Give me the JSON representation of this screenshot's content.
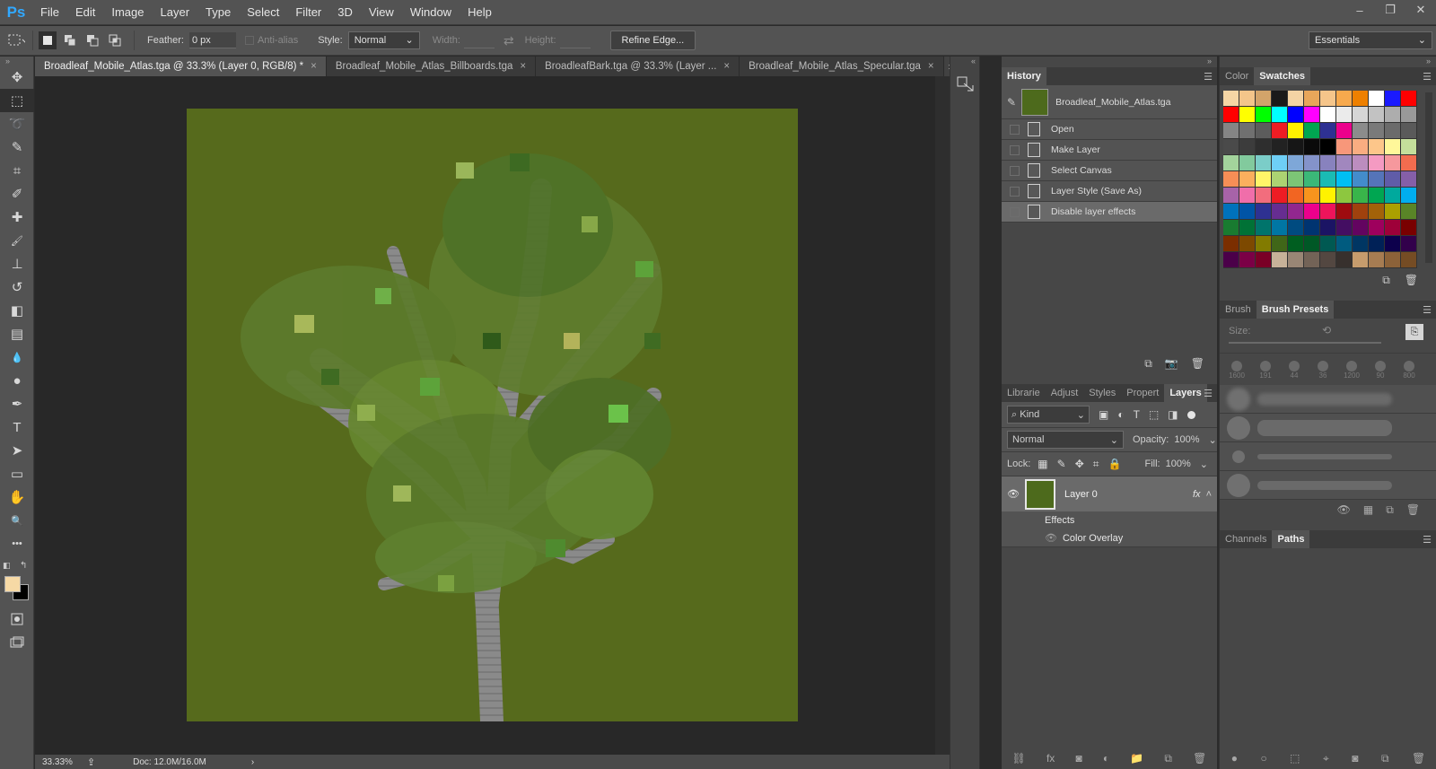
{
  "app": {
    "logo": "Ps",
    "menus": [
      "File",
      "Edit",
      "Image",
      "Layer",
      "Type",
      "Select",
      "Filter",
      "3D",
      "View",
      "Window",
      "Help"
    ],
    "window_controls": [
      "–",
      "❐",
      "✕"
    ]
  },
  "options_bar": {
    "feather_label": "Feather:",
    "feather_value": "0 px",
    "anti_alias_label": "Anti-alias",
    "style_label": "Style:",
    "style_value": "Normal",
    "width_label": "Width:",
    "height_label": "Height:",
    "refine_edge_label": "Refine Edge...",
    "workspace_value": "Essentials"
  },
  "tools": [
    {
      "name": "move-tool",
      "glyph": "✥"
    },
    {
      "name": "marquee-tool",
      "glyph": "⬚"
    },
    {
      "name": "lasso-tool",
      "glyph": "➰"
    },
    {
      "name": "quick-selection-tool",
      "glyph": "✎"
    },
    {
      "name": "crop-tool",
      "glyph": "⌗"
    },
    {
      "name": "eyedropper-tool",
      "glyph": "✐"
    },
    {
      "name": "healing-brush-tool",
      "glyph": "✚"
    },
    {
      "name": "brush-tool",
      "glyph": "🖌"
    },
    {
      "name": "clone-stamp-tool",
      "glyph": "⊥"
    },
    {
      "name": "history-brush-tool",
      "glyph": "↺"
    },
    {
      "name": "eraser-tool",
      "glyph": "◧"
    },
    {
      "name": "gradient-tool",
      "glyph": "▤"
    },
    {
      "name": "blur-tool",
      "glyph": "💧"
    },
    {
      "name": "dodge-tool",
      "glyph": "●"
    },
    {
      "name": "pen-tool",
      "glyph": "✒"
    },
    {
      "name": "type-tool",
      "glyph": "T"
    },
    {
      "name": "path-selection-tool",
      "glyph": "➤"
    },
    {
      "name": "rectangle-tool",
      "glyph": "▭"
    },
    {
      "name": "hand-tool",
      "glyph": "✋"
    },
    {
      "name": "zoom-tool",
      "glyph": "🔍"
    },
    {
      "name": "more-tools",
      "glyph": "•••"
    }
  ],
  "colors": {
    "foreground": "#f6d9a5",
    "background": "#000000",
    "canvas_bg": "#566a1c",
    "accent_blue": "#31a8ff"
  },
  "tabs": [
    {
      "label": "Broadleaf_Mobile_Atlas.tga @ 33.3% (Layer 0, RGB/8) *",
      "active": true
    },
    {
      "label": "Broadleaf_Mobile_Atlas_Billboards.tga",
      "active": false
    },
    {
      "label": "BroadleafBark.tga @ 33.3% (Layer ...",
      "active": false
    },
    {
      "label": "Broadleaf_Mobile_Atlas_Specular.tga",
      "active": false
    }
  ],
  "status": {
    "zoom": "33.33%",
    "doc": "Doc: 12.0M/16.0M"
  },
  "history": {
    "title": "History",
    "snapshot_name": "Broadleaf_Mobile_Atlas.tga",
    "steps": [
      "Open",
      "Make Layer",
      "Select Canvas",
      "Layer Style (Save As)",
      "Disable layer effects"
    ],
    "selected_index": 4
  },
  "color_panel": {
    "tabs": [
      "Color",
      "Swatches"
    ],
    "active": "Swatches"
  },
  "swatches": [
    [
      "#f6d6a5",
      "#f4c58a",
      "#d3a46a",
      "#1a1a1a",
      "#f3d3a4",
      "#e8a65a",
      "#f5c58a",
      "#f7a94d",
      "#ee8000",
      "#ffffff",
      "#1a1aff",
      "#ff0000"
    ],
    [
      "#ff0000",
      "#ffff00",
      "#00ff00",
      "#00ffff",
      "#0000ff",
      "#ff00ff",
      "#ffffff",
      "#ebebeb",
      "#d6d6d6",
      "#c2c2c2",
      "#adadad",
      "#999999"
    ],
    [
      "#858585",
      "#707070",
      "#5c5c5c",
      "#ee1d24",
      "#fff200",
      "#00a651",
      "#2e3192",
      "#ec008c",
      "#8c8c8c",
      "#7a7a7a",
      "#6b6b6b",
      "#5a5a5a"
    ],
    [
      "#4a4a4a",
      "#3c3c3c",
      "#2e2e2e",
      "#222222",
      "#161616",
      "#0a0a0a",
      "#000000",
      "#f7977a",
      "#f9ad81",
      "#fdc68a",
      "#fff79a",
      "#c4df9b"
    ],
    [
      "#a3d39c",
      "#82ca9d",
      "#7bcdc8",
      "#6ecff6",
      "#7ea7d8",
      "#8493ca",
      "#8882be",
      "#a187be",
      "#bc8dbf",
      "#f49ac2",
      "#f6989d",
      "#f26c4f"
    ],
    [
      "#f68e56",
      "#fbaf5d",
      "#fff568",
      "#acd372",
      "#7cc576",
      "#3bb878",
      "#1abbb4",
      "#00bff3",
      "#438ccb",
      "#5574b9",
      "#605ca8",
      "#855fa8"
    ],
    [
      "#a763a8",
      "#f06eaa",
      "#f26d7d",
      "#ed1c24",
      "#f26522",
      "#f7941d",
      "#fff200",
      "#8dc73f",
      "#39b54a",
      "#00a651",
      "#00a99d",
      "#00aeef"
    ],
    [
      "#0072bc",
      "#0054a6",
      "#2e3192",
      "#662d91",
      "#92278f",
      "#ec008c",
      "#ed145b",
      "#9e0b0f",
      "#a0410d",
      "#a36209",
      "#aba000",
      "#598527"
    ],
    [
      "#197b30",
      "#007236",
      "#00746b",
      "#0076a3",
      "#004b80",
      "#003471",
      "#1b1464",
      "#440e62",
      "#630460",
      "#9e005d",
      "#9e0039",
      "#790000"
    ],
    [
      "#7b2e00",
      "#7d4900",
      "#827b00",
      "#406618",
      "#005e20",
      "#005826",
      "#005952",
      "#005b7f",
      "#003663",
      "#002157",
      "#0d004c",
      "#32004b"
    ],
    [
      "#4b0049",
      "#7b0046",
      "#7a0026",
      "#c7b299",
      "#998675",
      "#736357",
      "#534741",
      "#37302d",
      "#c69c6d",
      "#a67c52",
      "#8c6239",
      "#754c24"
    ]
  ],
  "brush_panel": {
    "tabs": [
      "Brush",
      "Brush Presets"
    ],
    "active": "Brush Presets",
    "size_label": "Size:",
    "preset_sizes": [
      "1600",
      "191",
      "44",
      "36",
      "1200",
      "90",
      "800"
    ]
  },
  "layers_panel": {
    "tabs": [
      "Librarie",
      "Adjust",
      "Styles",
      "Propert",
      "Layers"
    ],
    "active": "Layers",
    "filter_label": "Kind",
    "blend_mode": "Normal",
    "opacity_label": "Opacity:",
    "opacity_value": "100%",
    "lock_label": "Lock:",
    "fill_label": "Fill:",
    "fill_value": "100%",
    "layer_name": "Layer 0",
    "fx_label": "fx",
    "effects_label": "Effects",
    "effect_name": "Color Overlay"
  },
  "paths_panel": {
    "tabs": [
      "Channels",
      "Paths"
    ],
    "active": "Paths"
  }
}
